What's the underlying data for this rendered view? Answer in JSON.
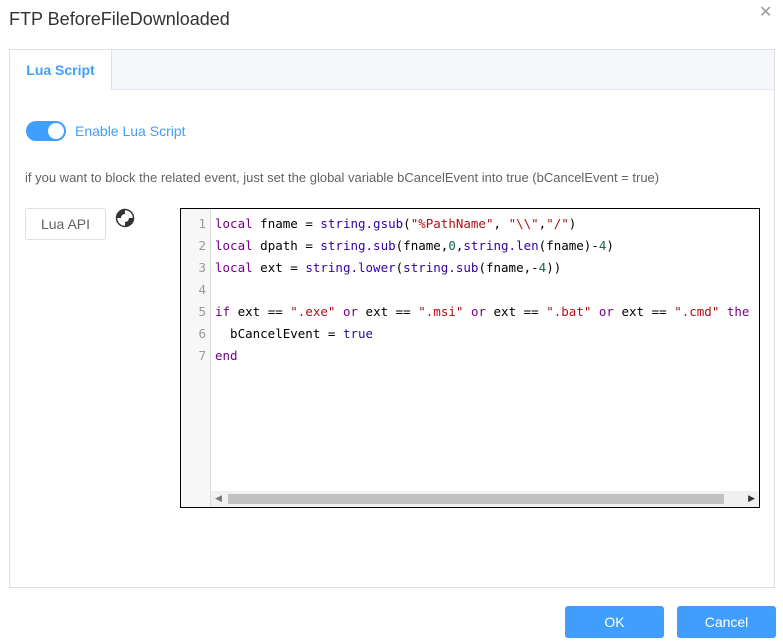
{
  "dialog": {
    "title": "FTP BeforeFileDownloaded",
    "close_icon": "close-icon"
  },
  "tabs": [
    {
      "label": "Lua Script",
      "active": true
    }
  ],
  "toggle": {
    "label": "Enable Lua Script",
    "enabled": true
  },
  "hint": "if you want to block the related event, just set the global variable bCancelEvent into true (bCancelEvent = true)",
  "api_button": {
    "label": "Lua API"
  },
  "help_icon": "help-icon",
  "editor": {
    "line_numbers": [
      "1",
      "2",
      "3",
      "4",
      "5",
      "6",
      "7"
    ],
    "lines": [
      "local fname = string.gsub(\"%PathName\", \"\\\\\",\"/\")",
      "local dpath = string.sub(fname,0,string.len(fname)-4)",
      "local ext = string.lower(string.sub(fname,-4))",
      "",
      "if ext == \".exe\" or ext == \".msi\" or ext == \".bat\" or ext == \".cmd\" the",
      "  bCancelEvent = true",
      "end"
    ]
  },
  "footer": {
    "ok_label": "OK",
    "cancel_label": "Cancel"
  },
  "colors": {
    "accent": "#409eff",
    "keyword": "#770088",
    "string": "#aa1111",
    "number": "#116644"
  }
}
